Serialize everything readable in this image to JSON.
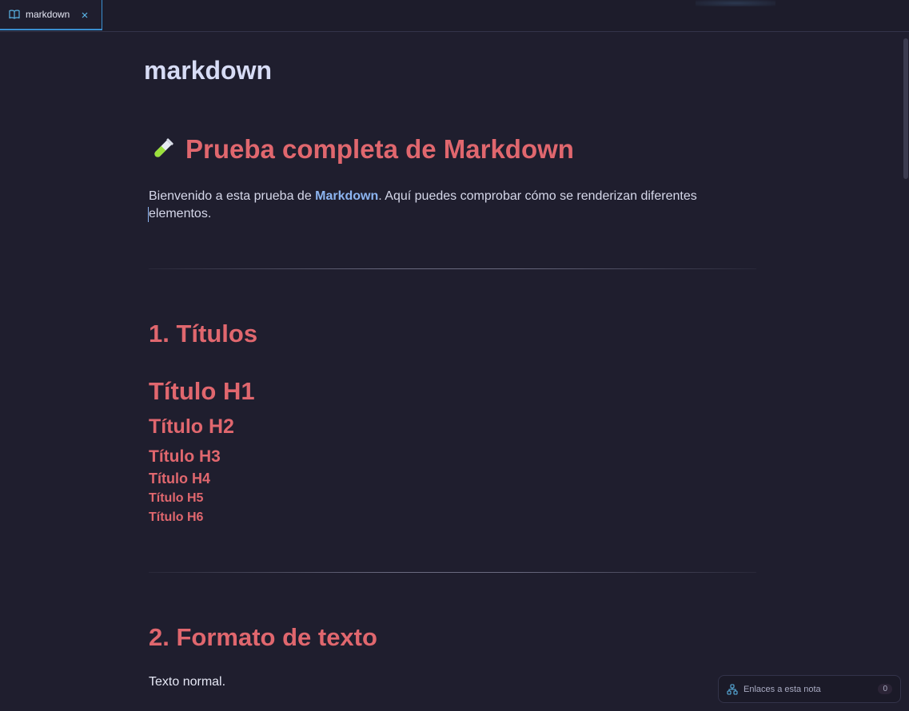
{
  "tab": {
    "label": "markdown",
    "icon": "book-icon",
    "close_icon": "close-icon"
  },
  "note": {
    "title": "markdown",
    "heading_main": "Prueba completa de Markdown",
    "heading_icon": "test-tube-icon",
    "intro_before": "Bienvenido a esta prueba de ",
    "intro_bold": "Markdown",
    "intro_after": ". Aquí puedes comprobar cómo se renderizan diferentes elementos.",
    "section1": "1. Títulos",
    "h1": "Título H1",
    "h2": "Título H2",
    "h3": "Título H3",
    "h4": "Título H4",
    "h5": "Título H5",
    "h6": "Título H6",
    "section2": "2. Formato de texto",
    "normal_text": "Texto normal."
  },
  "backlinks": {
    "label": "Enlaces a esta nota",
    "count": "0",
    "icon": "network-icon"
  },
  "colors": {
    "background": "#1f1e2e",
    "heading": "#e0676e",
    "accent": "#3a8fd1",
    "bold_text": "#8cb4f0"
  }
}
